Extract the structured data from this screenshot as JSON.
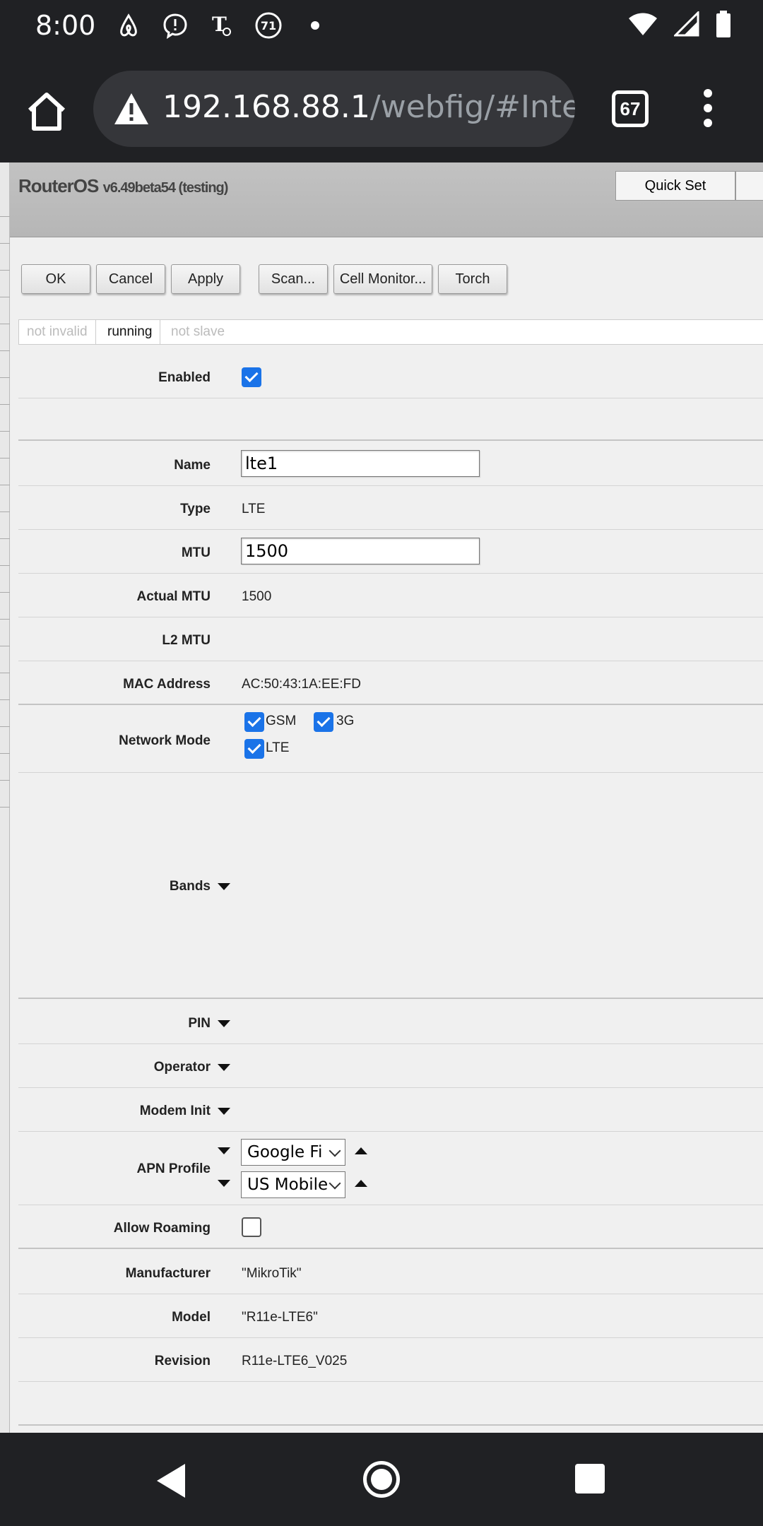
{
  "status_bar": {
    "time": "8:00",
    "notification_icons": [
      "airbnb-icon",
      "messenger-icon",
      "tmobile-icon",
      "badge-71-icon",
      "dot-icon"
    ],
    "badge_count": "71",
    "system_icons": [
      "wifi-icon",
      "signal-icon",
      "battery-icon"
    ]
  },
  "browser": {
    "url_host": "192.168.88.1",
    "url_path": "/webfig/#Interfa",
    "tab_count": "67"
  },
  "routeros": {
    "brand": "RouterOS",
    "version": "v6.49beta54 (testing)",
    "quick_set": "Quick Set"
  },
  "buttons": {
    "ok": "OK",
    "cancel": "Cancel",
    "apply": "Apply",
    "scan": "Scan...",
    "cell_monitor": "Cell Monitor...",
    "torch": "Torch"
  },
  "flags": [
    "not invalid",
    "running",
    "not slave"
  ],
  "form": {
    "enabled_label": "Enabled",
    "enabled": true,
    "name_label": "Name",
    "name_value": "lte1",
    "type_label": "Type",
    "type_value": "LTE",
    "mtu_label": "MTU",
    "mtu_value": "1500",
    "actual_mtu_label": "Actual MTU",
    "actual_mtu_value": "1500",
    "l2mtu_label": "L2 MTU",
    "mac_label": "MAC Address",
    "mac_value": "AC:50:43:1A:EE:FD",
    "network_mode_label": "Network Mode",
    "network_modes": [
      {
        "label": "GSM",
        "checked": true
      },
      {
        "label": "3G",
        "checked": true
      },
      {
        "label": "LTE",
        "checked": true
      }
    ],
    "bands_label": "Bands",
    "pin_label": "PIN",
    "operator_label": "Operator",
    "modem_init_label": "Modem Init",
    "apn_profile_label": "APN Profile",
    "apn_profiles": [
      "Google Fi",
      "US Mobile"
    ],
    "allow_roaming_label": "Allow Roaming",
    "allow_roaming": false,
    "manufacturer_label": "Manufacturer",
    "manufacturer_value": "\"MikroTik\"",
    "model_label": "Model",
    "model_value": "\"R11e-LTE6\"",
    "revision_label": "Revision",
    "revision_value": "R11e-LTE6_V025"
  }
}
